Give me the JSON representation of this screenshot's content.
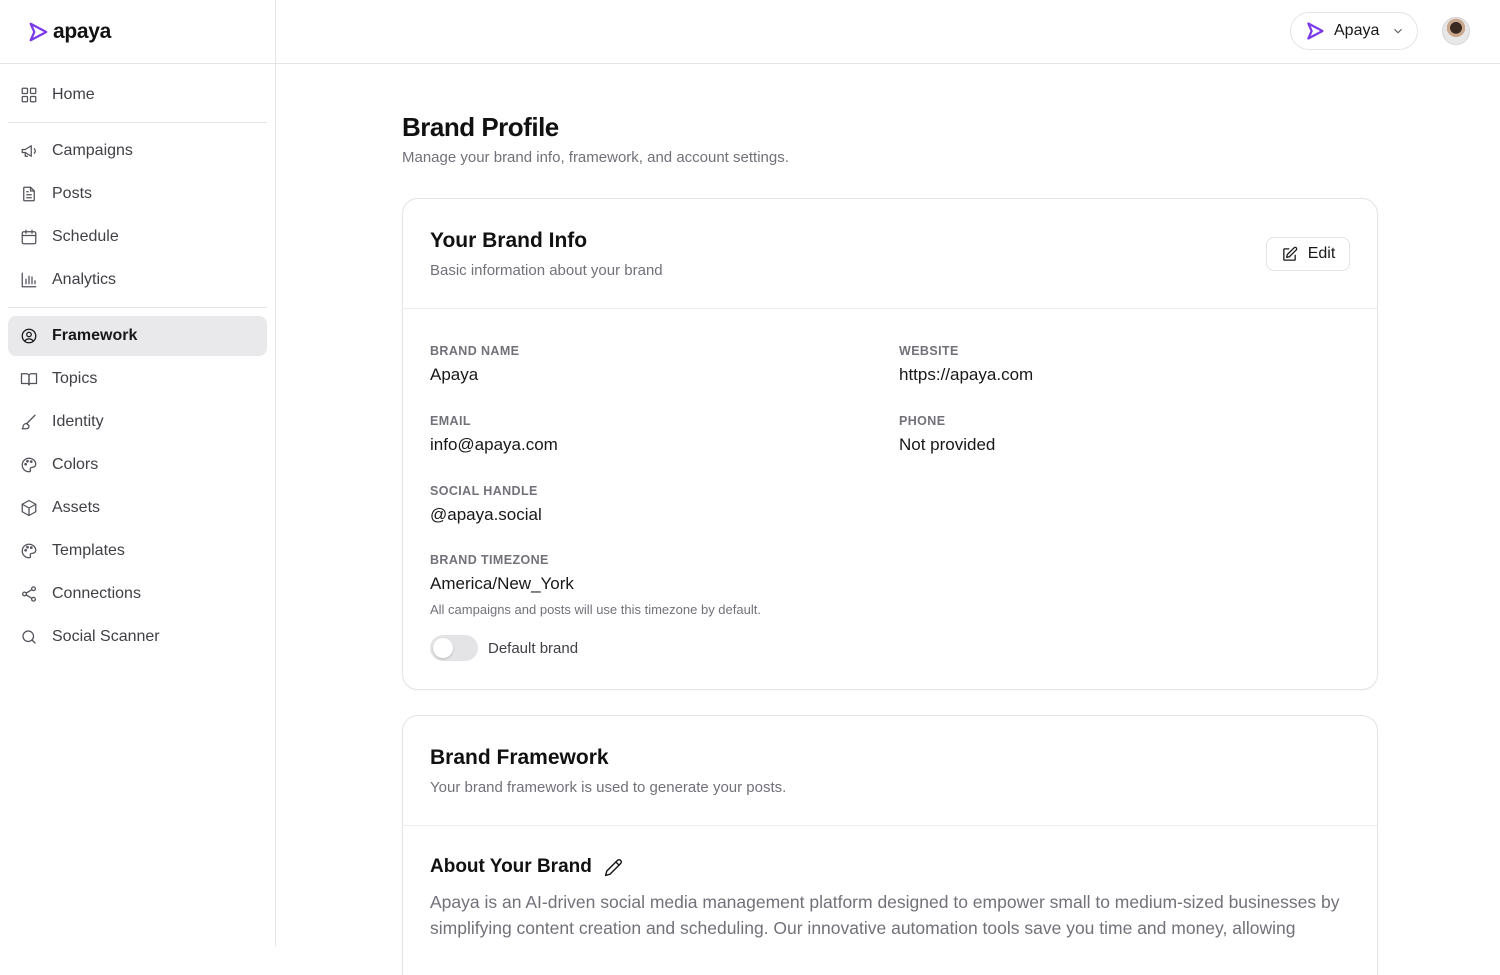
{
  "app": {
    "logo_text": "apaya",
    "brand_color": "#7c3aed"
  },
  "sidebar": {
    "items": [
      {
        "label": "Home",
        "icon": "grid-icon"
      },
      {
        "label": "Campaigns",
        "icon": "megaphone-icon"
      },
      {
        "label": "Posts",
        "icon": "document-icon"
      },
      {
        "label": "Schedule",
        "icon": "calendar-icon"
      },
      {
        "label": "Analytics",
        "icon": "bar-chart-icon"
      },
      {
        "label": "Framework",
        "icon": "user-circle-icon",
        "active": true
      },
      {
        "label": "Topics",
        "icon": "book-open-icon"
      },
      {
        "label": "Identity",
        "icon": "brush-icon"
      },
      {
        "label": "Colors",
        "icon": "palette-icon"
      },
      {
        "label": "Assets",
        "icon": "package-icon"
      },
      {
        "label": "Templates",
        "icon": "palette-icon"
      },
      {
        "label": "Connections",
        "icon": "share-icon"
      },
      {
        "label": "Social Scanner",
        "icon": "search-icon"
      }
    ]
  },
  "topbar": {
    "brand_switcher_label": "Apaya"
  },
  "page": {
    "title": "Brand Profile",
    "subtitle": "Manage your brand info, framework, and account settings."
  },
  "brand_info": {
    "title": "Your Brand Info",
    "description": "Basic information about your brand",
    "edit_label": "Edit",
    "fields": {
      "brand_name": {
        "label": "BRAND NAME",
        "value": "Apaya"
      },
      "website": {
        "label": "WEBSITE",
        "value": "https://apaya.com"
      },
      "email": {
        "label": "EMAIL",
        "value": "info@apaya.com"
      },
      "phone": {
        "label": "PHONE",
        "value": "Not provided"
      },
      "social_handle": {
        "label": "SOCIAL HANDLE",
        "value": "@apaya.social"
      },
      "timezone": {
        "label": "BRAND TIMEZONE",
        "value": "America/New_York"
      }
    },
    "timezone_hint": "All campaigns and posts will use this timezone by default.",
    "default_brand_label": "Default brand",
    "default_brand_on": false
  },
  "brand_framework": {
    "title": "Brand Framework",
    "description": "Your brand framework is used to generate your posts.",
    "about_title": "About Your Brand",
    "about_text": "Apaya is an AI-driven social media management platform designed to empower small to medium-sized businesses by simplifying content creation and scheduling. Our innovative automation tools save you time and money, allowing"
  }
}
